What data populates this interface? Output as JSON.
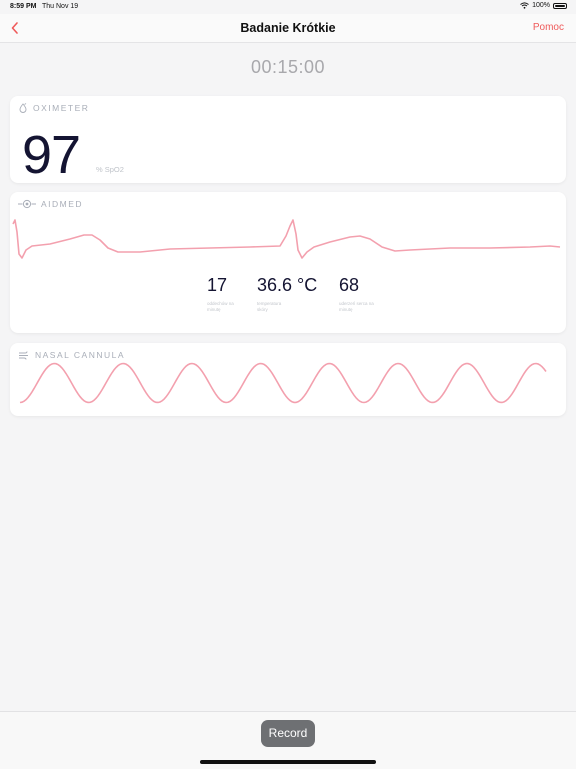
{
  "status_bar": {
    "time": "8:59 PM",
    "date": "Thu Nov 19",
    "battery": "100%"
  },
  "nav": {
    "title": "Badanie Krótkie",
    "help": "Pomoc",
    "back_icon": "chevron-left-icon"
  },
  "timer": "00:15:00",
  "oximeter": {
    "title": "OXIMETER",
    "value": "97",
    "unit": "% SpO2",
    "icon": "drop-icon"
  },
  "aidmed": {
    "title": "AIDMED",
    "icon": "device-icon",
    "metrics": [
      {
        "value": "17",
        "label": "oddechów na minutę"
      },
      {
        "value": "36.6 °C",
        "label": "temperatura skóry"
      },
      {
        "value": "68",
        "label": "uderzeń serca na minutę"
      }
    ]
  },
  "nasal": {
    "title": "NASAL CANNULA",
    "icon": "airflow-icon"
  },
  "bottom": {
    "record": "Record"
  },
  "colors": {
    "accent": "#ef5a5a",
    "wave": "#f3a0ae",
    "value_text": "#141432"
  }
}
